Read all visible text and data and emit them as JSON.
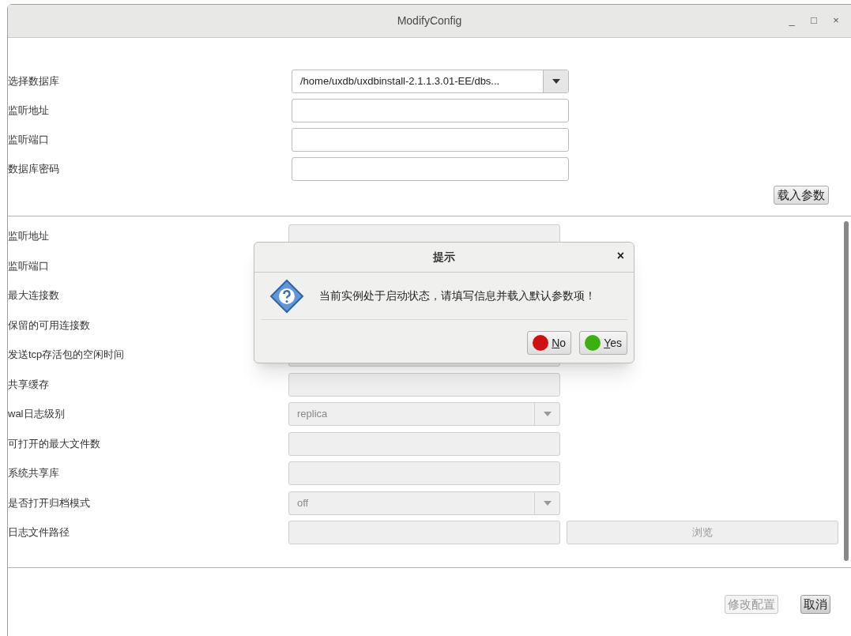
{
  "window": {
    "title": "ModifyConfig",
    "controls": [
      "_",
      "□",
      "×"
    ]
  },
  "connection": [
    {
      "label": "选择数据库",
      "kind": "combo",
      "value": "/home/uxdb/uxdbinstall-2.1.1.3.01-EE/dbs..."
    },
    {
      "label": "监听地址",
      "kind": "field"
    },
    {
      "label": "监听端口",
      "kind": "field"
    },
    {
      "label": "数据库密码",
      "kind": "field"
    }
  ],
  "load_button": "载入参数",
  "parameters": [
    {
      "label": "监听地址",
      "kind": "field",
      "disabled": true
    },
    {
      "label": "监听端口",
      "kind": "label"
    },
    {
      "label": "最大连接数",
      "kind": "label"
    },
    {
      "label": "保留的可用连接数",
      "kind": "label"
    },
    {
      "label": "发送tcp存活包的空闲时间",
      "kind": "field",
      "disabled": true
    },
    {
      "label": "共享缓存",
      "kind": "field",
      "disabled": true
    },
    {
      "label": "wal日志级别",
      "kind": "combo",
      "value": "replica",
      "disabled": true
    },
    {
      "label": "可打开的最大文件数",
      "kind": "field",
      "disabled": true
    },
    {
      "label": "系统共享库",
      "kind": "field",
      "disabled": true
    },
    {
      "label": "是否打开归档模式",
      "kind": "combo",
      "value": "off",
      "disabled": true
    },
    {
      "label": "日志文件路径",
      "kind": "browse",
      "button": "浏览",
      "disabled": true
    }
  ],
  "footer_buttons": [
    {
      "label": "修改配置",
      "disabled": true
    },
    {
      "label": "取消",
      "disabled": false
    }
  ],
  "dialog": {
    "title": "提示",
    "close": "×",
    "message": "当前实例处于启动状态，请填写信息并载入默认参数项！",
    "buttons": [
      {
        "label": "No",
        "color": "#d01010"
      },
      {
        "label": "Yes",
        "color": "#3cb010"
      }
    ]
  }
}
